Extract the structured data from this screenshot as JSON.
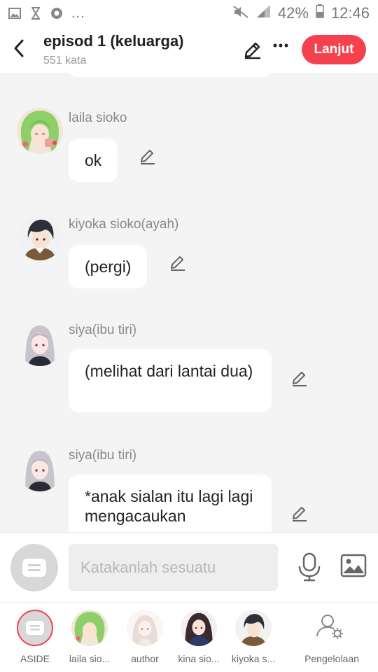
{
  "status_bar": {
    "battery": "42%",
    "time": "12:46",
    "overflow": "..."
  },
  "header": {
    "title": "episod 1 (keluarga)",
    "word_count": "551 kata",
    "next_label": "Lanjut"
  },
  "messages": [
    {
      "sender": "laila sioko",
      "text": "ok"
    },
    {
      "sender": "kiyoka sioko(ayah)",
      "text": "(pergi)"
    },
    {
      "sender": "siya(ibu tiri)",
      "text": "(melihat dari lantai dua)"
    },
    {
      "sender": "siya(ibu tiri)",
      "text": "*anak sialan itu lagi lagi mengacaukan"
    }
  ],
  "input": {
    "placeholder": "Katakanlah sesuatu"
  },
  "characters": [
    {
      "label": "ASIDE"
    },
    {
      "label": "laila sio..."
    },
    {
      "label": "author"
    },
    {
      "label": "kina sio..."
    },
    {
      "label": "kiyoka s..."
    },
    {
      "label": "Pengelolaan"
    }
  ],
  "colors": {
    "accent": "#f5414d",
    "background": "#f4f4f4"
  }
}
